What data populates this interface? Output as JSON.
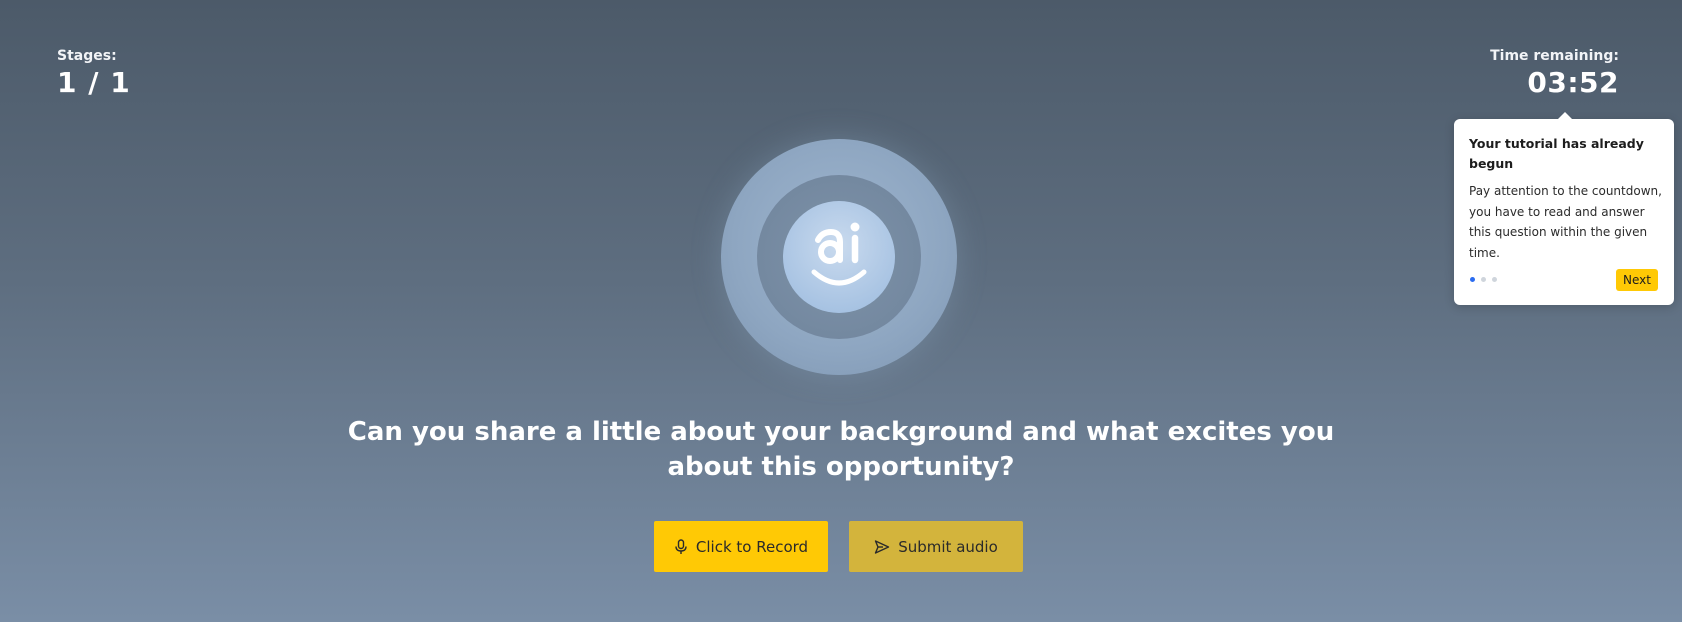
{
  "stages": {
    "label": "Stages:",
    "value": "1 / 1"
  },
  "timer": {
    "label": "Time remaining:",
    "value": "03:52"
  },
  "avatar": {
    "icon": "ai-smile-logo"
  },
  "question": {
    "text": "Can you share a little about your background and what excites you about this opportunity?"
  },
  "actions": {
    "record_label": "Click to Record",
    "record_icon": "microphone-icon",
    "submit_label": "Submit audio",
    "submit_icon": "send-icon"
  },
  "tutorial": {
    "title": "Your tutorial has already begun",
    "body": "Pay attention to the countdown, you have to read and answer this question within the given time.",
    "step": 1,
    "steps_total": 3,
    "next_label": "Next"
  },
  "colors": {
    "accent": "#ffc905",
    "accent_muted": "#d3b43c",
    "dot_active": "#2b6cf0"
  }
}
